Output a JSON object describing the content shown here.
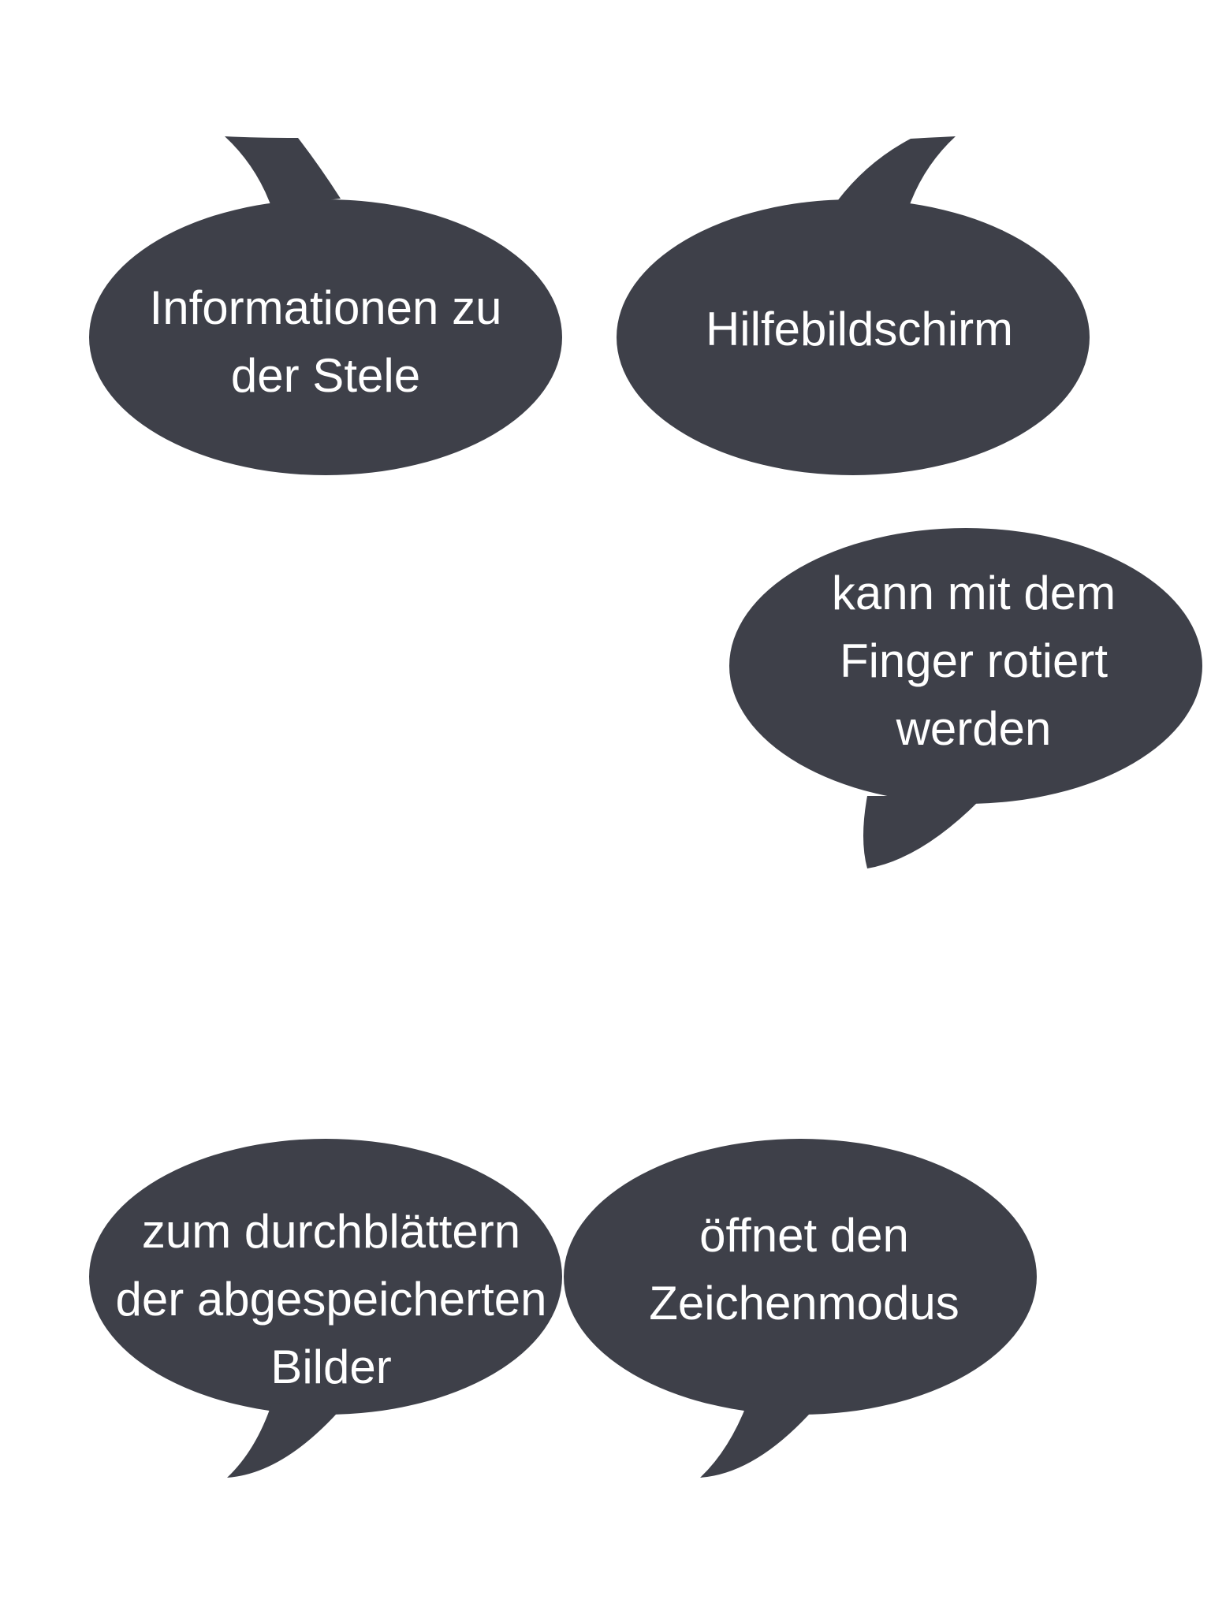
{
  "colors": {
    "bubble_fill": "#3e4049",
    "text": "#ffffff",
    "background": "#ffffff"
  },
  "bubbles": [
    {
      "id": "info-bubble",
      "lines": [
        "Informationen zu",
        "der Stele"
      ]
    },
    {
      "id": "help-bubble",
      "lines": [
        "Hilfebildschirm"
      ]
    },
    {
      "id": "rotate-bubble",
      "lines": [
        "kann mit dem",
        "Finger rotiert",
        "werden"
      ]
    },
    {
      "id": "browse-bubble",
      "lines": [
        "zum durchblättern",
        "der abgespeicherten",
        "Bilder"
      ]
    },
    {
      "id": "draw-bubble",
      "lines": [
        "öffnet den",
        "Zeichenmodus"
      ]
    }
  ]
}
